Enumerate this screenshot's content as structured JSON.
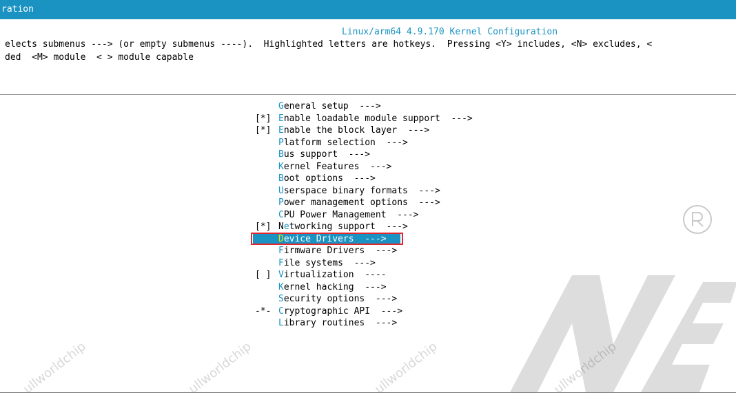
{
  "window": {
    "title_fragment": "ration"
  },
  "config": {
    "title": "Linux/arm64 4.9.170 Kernel Configuration",
    "help_line1": "elects submenus ---> (or empty submenus ----).  Highlighted letters are hotkeys.  Pressing <Y> includes, <N> excludes, <",
    "help_line2": "ded  <M> module  < > module capable"
  },
  "menu": {
    "items": [
      {
        "prefix": "",
        "hot": "G",
        "rest": "eneral setup  --->"
      },
      {
        "prefix": "[*]",
        "hot": "E",
        "rest": "nable loadable module support  --->"
      },
      {
        "prefix": "[*]",
        "hot": "E",
        "rest": "nable the block layer  --->"
      },
      {
        "prefix": "",
        "hot": "P",
        "rest": "latform selection  --->"
      },
      {
        "prefix": "",
        "hot": "B",
        "rest": "us support  --->"
      },
      {
        "prefix": "",
        "hot": "K",
        "rest": "ernel Features  --->"
      },
      {
        "prefix": "",
        "hot": "B",
        "rest": "oot options  --->"
      },
      {
        "prefix": "",
        "hot": "U",
        "rest": "serspace binary formats  --->"
      },
      {
        "prefix": "",
        "hot": "P",
        "rest": "ower management options  --->"
      },
      {
        "prefix": "",
        "hot": "C",
        "rest": "PU Power Management  --->"
      },
      {
        "prefix": "[*]",
        "hot": "",
        "rest": "N",
        "pre": "N",
        "hot2": "e",
        "rest2": "tworking support  --->"
      },
      {
        "prefix": "",
        "hot": "D",
        "rest": "evice Drivers  --->",
        "selected": true
      },
      {
        "prefix": "",
        "hot": "F",
        "rest": "irmware Drivers  --->"
      },
      {
        "prefix": "",
        "hot": "F",
        "rest": "ile systems  --->"
      },
      {
        "prefix": "[ ]",
        "hot": "V",
        "rest": "irtualization  ----"
      },
      {
        "prefix": "",
        "hot": "K",
        "rest": "ernel hacking  --->"
      },
      {
        "prefix": "",
        "hot": "S",
        "rest": "ecurity options  --->"
      },
      {
        "prefix": "-*-",
        "hot": "C",
        "rest": "ryptographic API  --->"
      },
      {
        "prefix": "",
        "hot": "L",
        "rest": "ibrary routines  --->"
      }
    ]
  },
  "watermark": {
    "text": "ullworldchip",
    "logo_letters": "NER"
  },
  "colors": {
    "accent": "#1a93c2",
    "hotkey_selected": "#e6e600",
    "highlight_box": "#e3262b"
  }
}
